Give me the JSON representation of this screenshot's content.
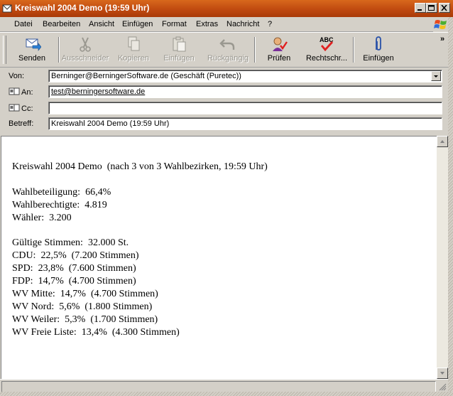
{
  "window": {
    "title": "Kreiswahl 2004 Demo (19:59 Uhr)"
  },
  "menu": {
    "items": [
      "Datei",
      "Bearbeiten",
      "Ansicht",
      "Einfügen",
      "Format",
      "Extras",
      "Nachricht",
      "?"
    ]
  },
  "toolbar": {
    "send": "Senden",
    "cut": "Ausschneider",
    "copy": "Kopieren",
    "paste": "Einfügen",
    "undo": "Rückgängig",
    "check": "Prüfen",
    "spelling": "Rechtschr...",
    "attach": "Einfügen",
    "more": "»",
    "spell_icon_text": "ABC"
  },
  "fields": {
    "from_label": "Von:",
    "from_value": "Berninger@BerningerSoftware.de   (Geschäft (Puretec))",
    "to_label": "An:",
    "to_value": "test@berningersoftware.de",
    "cc_label": "Cc:",
    "cc_value": "",
    "subject_label": "Betreff:",
    "subject_value": "Kreiswahl 2004 Demo (19:59 Uhr)"
  },
  "message": {
    "heading": "Kreiswahl 2004 Demo  (nach 3 von 3 Wahlbezirken, 19:59 Uhr)",
    "turnout": "Wahlbeteiligung:  66,4%",
    "eligible": "Wahlberechtigte:  4.819",
    "voters": "Wähler:  3.200",
    "valid_votes": "Gültige Stimmen:  32.000 St.",
    "results": [
      "CDU:  22,5%  (7.200 Stimmen)",
      "SPD:  23,8%  (7.600 Stimmen)",
      "FDP:  14,7%  (4.700 Stimmen)",
      "WV Mitte:  14,7%  (4.700 Stimmen)",
      "WV Nord:  5,6%  (1.800 Stimmen)",
      "WV Weiler:  5,3%  (1.700 Stimmen)",
      "WV Freie Liste:  13,4%  (4.300 Stimmen)"
    ]
  },
  "colors": {
    "titlebar": "#c04a10",
    "window_bg": "#d4d0c8",
    "disabled_text": "#9a9890"
  },
  "icons": {
    "send": "send-mail-icon",
    "cut": "scissors-icon",
    "copy": "copy-icon",
    "paste": "paste-icon",
    "undo": "undo-icon",
    "check": "check-names-icon",
    "spelling": "spellcheck-icon",
    "attach": "paperclip-icon"
  }
}
